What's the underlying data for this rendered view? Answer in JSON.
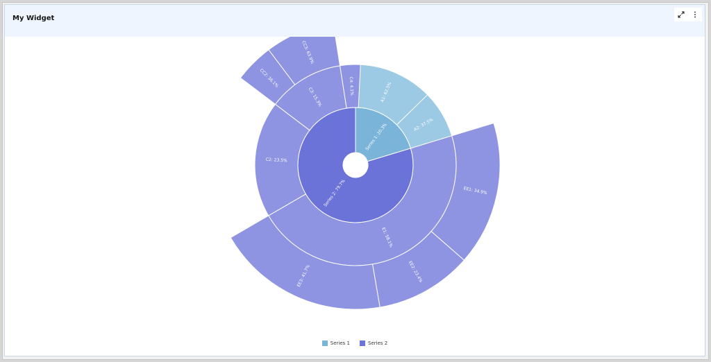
{
  "widget": {
    "title": "My Widget",
    "maximize_icon": "maximize-icon",
    "menu_icon": "overflow-menu-icon"
  },
  "chart_data": {
    "type": "sunburst",
    "title": "",
    "colors": {
      "series_1_inner": "#7ab4d8",
      "series_1_outer": "#9ccae4",
      "series_2_inner": "#6b72d8",
      "series_2_outer": "#8e94e2"
    },
    "legend": {
      "placement": "bottom-center",
      "items": [
        {
          "name": "Series 1",
          "color": "#7ab4d8"
        },
        {
          "name": "Series 2",
          "color": "#6b72d8"
        }
      ]
    },
    "rings": [
      {
        "level": 1,
        "segments": [
          {
            "label": "Series 1: 20.3%",
            "series": "Series 1",
            "percent": 20.3
          },
          {
            "label": "Series 2: 79.7%",
            "series": "Series 2",
            "percent": 79.7
          }
        ]
      },
      {
        "level": 2,
        "segments": [
          {
            "label": "A1: 62.5%",
            "series": "Series 1",
            "parent": "Series 1",
            "percent": 62.5
          },
          {
            "label": "A2: 37.5%",
            "series": "Series 1",
            "parent": "Series 1",
            "percent": 37.5
          },
          {
            "label": "E1: 58.1%",
            "series": "Series 2",
            "parent": "Series 2",
            "percent": 58.1
          },
          {
            "label": "C2: 23.5%",
            "series": "Series 2",
            "parent": "Series 2",
            "percent": 23.5
          },
          {
            "label": "C3: 15.3%",
            "series": "Series 2",
            "parent": "Series 2",
            "percent": 15.3
          },
          {
            "label": "C4: 4.1%",
            "series": "Series 2",
            "parent": "Series 2",
            "percent": 4.1
          }
        ]
      },
      {
        "level": 3,
        "segments": [
          {
            "label": "EE1: 34.9%",
            "series": "Series 2",
            "parent": "E1",
            "percent": 34.9
          },
          {
            "label": "EE2: 23.4%",
            "series": "Series 2",
            "parent": "E1",
            "percent": 23.4
          },
          {
            "label": "EE3: 41.7%",
            "series": "Series 2",
            "parent": "E1",
            "percent": 41.7
          },
          {
            "label": "CC2: 36.1%",
            "series": "Series 2",
            "parent": "C3",
            "percent": 36.1
          },
          {
            "label": "CC3: 63.9%",
            "series": "Series 2",
            "parent": "C3",
            "percent": 63.9
          }
        ]
      }
    ]
  }
}
